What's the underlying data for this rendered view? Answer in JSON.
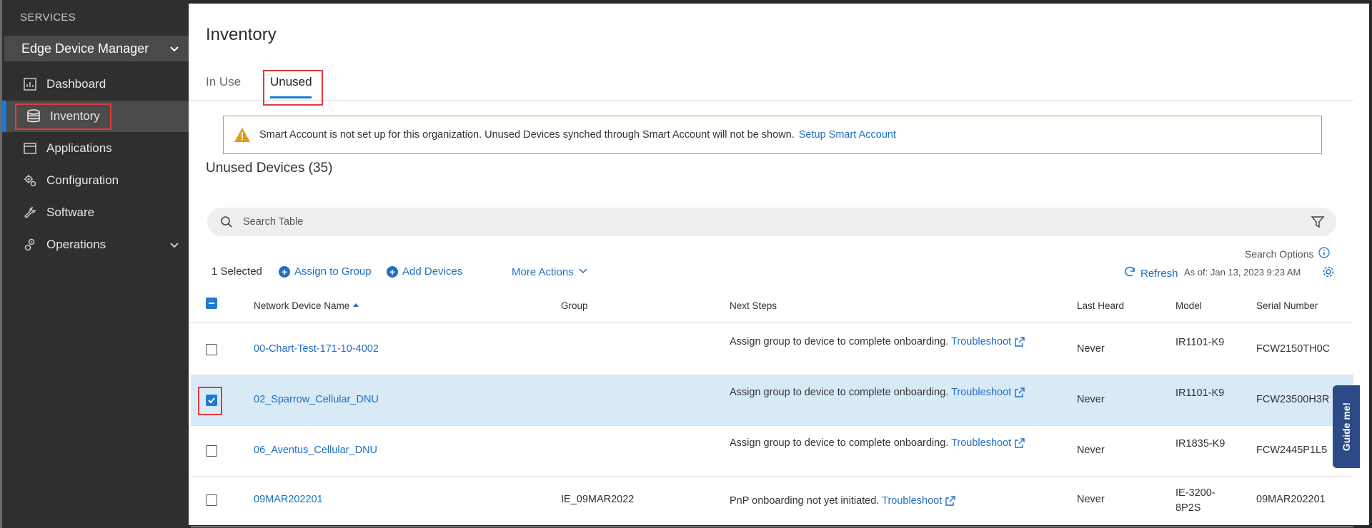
{
  "sidebar": {
    "services_label": "SERVICES",
    "section_title": "Edge Device Manager",
    "items": [
      {
        "label": "Dashboard",
        "icon": "dashboard-icon"
      },
      {
        "label": "Inventory",
        "icon": "database-icon"
      },
      {
        "label": "Applications",
        "icon": "window-icon"
      },
      {
        "label": "Configuration",
        "icon": "gear-cluster-icon"
      },
      {
        "label": "Software",
        "icon": "wrench-icon"
      },
      {
        "label": "Operations",
        "icon": "operations-icon"
      }
    ]
  },
  "page": {
    "title": "Inventory",
    "tabs": [
      {
        "label": "In Use"
      },
      {
        "label": "Unused"
      }
    ]
  },
  "alert": {
    "message": "Smart Account is not set up for this organization. Unused Devices synched through Smart Account will not be shown.",
    "link": "Setup Smart Account"
  },
  "section_title": "Unused Devices (35)",
  "search": {
    "placeholder": "Search Table"
  },
  "search_options": "Search Options",
  "toolbar": {
    "selected": "1 Selected",
    "assign_group": "Assign to Group",
    "add_devices": "Add Devices",
    "more_actions": "More Actions",
    "refresh": "Refresh",
    "as_of": "As of: Jan 13, 2023 9:23 AM"
  },
  "table": {
    "headers": {
      "name": "Network Device Name",
      "group": "Group",
      "next_steps": "Next Steps",
      "last_heard": "Last Heard",
      "model": "Model",
      "serial": "Serial Number"
    },
    "rows": [
      {
        "name": "00-Chart-Test-171-10-4002",
        "group": "",
        "next_text": "Assign group to device to complete onboarding.",
        "next_link": "Troubleshoot",
        "last_heard": "Never",
        "model": "IR1101-K9",
        "serial": "FCW2150TH0C",
        "selected": false
      },
      {
        "name": "02_Sparrow_Cellular_DNU",
        "group": "",
        "next_text": "Assign group to device to complete onboarding.",
        "next_link": "Troubleshoot",
        "last_heard": "Never",
        "model": "IR1101-K9",
        "serial": "FCW23500H3R",
        "selected": true
      },
      {
        "name": "06_Aventus_Cellular_DNU",
        "group": "",
        "next_text": "Assign group to device to complete onboarding.",
        "next_link": "Troubleshoot",
        "last_heard": "Never",
        "model": "IR1835-K9",
        "serial": "FCW2445P1L5",
        "selected": false
      },
      {
        "name": "09MAR202201",
        "group": "IE_09MAR2022",
        "next_text": "PnP onboarding not yet initiated.",
        "next_link": "Troubleshoot",
        "last_heard": "Never",
        "model": "IE-3200-8P2S",
        "serial": "09MAR202201",
        "selected": false
      }
    ]
  },
  "guide_me": "Guide me!",
  "colors": {
    "accent": "#1f7ad1",
    "link": "#1f6fc4",
    "sidebar_bg": "#2f2f2f",
    "highlight": "#e03b3b",
    "warning": "#d39a2b"
  }
}
